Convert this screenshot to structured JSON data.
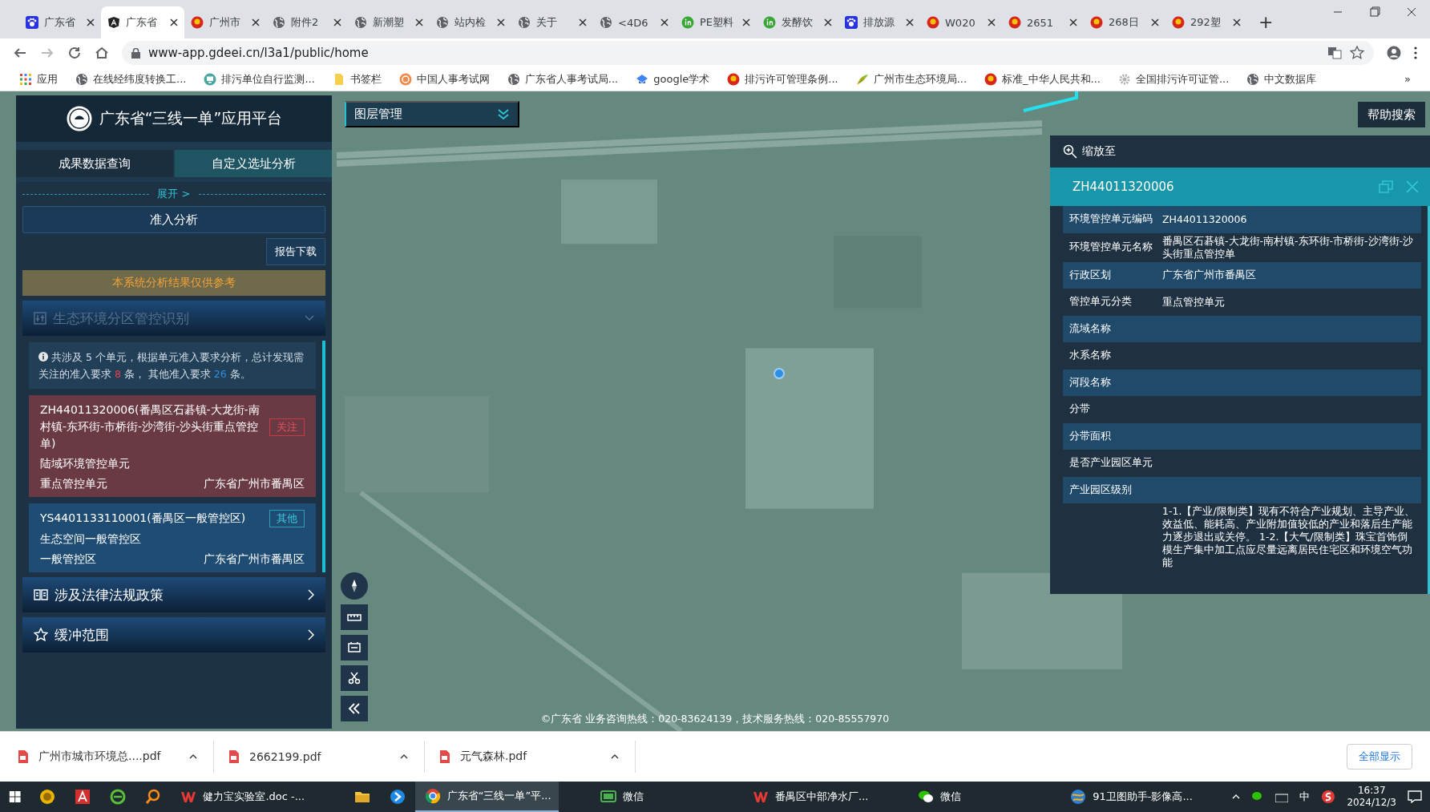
{
  "browser": {
    "tabs": [
      {
        "title": "广东省",
        "selected": false
      },
      {
        "title": "广东省",
        "selected": true
      },
      {
        "title": "广州市",
        "selected": false
      },
      {
        "title": "附件2",
        "selected": false
      },
      {
        "title": "新潮塑",
        "selected": false
      },
      {
        "title": "站内检",
        "selected": false
      },
      {
        "title": "关于",
        "selected": false
      },
      {
        "title": "<4D6",
        "selected": false
      },
      {
        "title": "PE塑料",
        "selected": false
      },
      {
        "title": "发酵饮",
        "selected": false
      },
      {
        "title": "排放源",
        "selected": false
      },
      {
        "title": "W020",
        "selected": false
      },
      {
        "title": "2651",
        "selected": false
      },
      {
        "title": "268日",
        "selected": false
      },
      {
        "title": "292塑",
        "selected": false
      }
    ],
    "new_tab": "+",
    "url": "www-app.gdeei.cn/l3a1/public/home",
    "bookmarks": [
      "应用",
      "在线经纬度转换工...",
      "排污单位自行监测...",
      "书签栏",
      "中国人事考试网",
      "广东省人事考试局...",
      "google学术",
      "排污许可管理条例...",
      "广州市生态环境局...",
      "标准_中华人民共和...",
      "全国排污许可证管...",
      "中文数据库"
    ],
    "bookmarks_more": "»"
  },
  "app": {
    "title": "广东省“三线一单”应用平台",
    "tabs": [
      {
        "label": "成果数据查询",
        "selected": false
      },
      {
        "label": "自定义选址分析",
        "selected": true
      }
    ],
    "expand_link": "展开 >",
    "analysis_button": "准入分析",
    "report_button": "报告下载",
    "notice": "本系统分析结果仅供参考",
    "sections": [
      {
        "title": "生态环境分区管控识别",
        "expanded": true,
        "summary": [
          {
            "kind": "text",
            "text": "共涉及 5 个单元，根据单元准入要求分析，总计发现需关注的准入要求 "
          },
          {
            "kind": "attention",
            "text": "8"
          },
          {
            "kind": "text",
            "text": " 条， 其他准入要求 "
          },
          {
            "kind": "other",
            "text": "26"
          },
          {
            "kind": "text",
            "text": " 条。"
          }
        ],
        "cards": [
          {
            "kind": "attention",
            "name": "ZH44011320006(番禺区石碁镇-大龙街-南村镇-东环街-市桥街-沙湾街-沙头街重点管控单)",
            "tag": "关注",
            "type": "陆域环境管控单元",
            "category": "重点管控单元",
            "region": "广东省广州市番禺区"
          },
          {
            "kind": "other",
            "name": "YS4401133110001(番禺区一般管控区)",
            "tag": "其他",
            "type": "生态空间一般管控区",
            "category": "一般管控区",
            "region": "广东省广州市番禺区"
          }
        ]
      },
      {
        "title": "涉及法律法规政策",
        "expanded": false
      },
      {
        "title": "缓冲范围",
        "expanded": false
      }
    ]
  },
  "map": {
    "layer_menu": "图层管理",
    "help_button": "帮助搜索",
    "footer": "©广东省 业务咨询热线：020-83624139，技术服务热线：020-85557970"
  },
  "popup": {
    "zoom_to": "缩放至",
    "title": "ZH44011320006",
    "rows": [
      {
        "label": "环境管控单元编码",
        "value": "ZH44011320006"
      },
      {
        "label": "环境管控单元名称",
        "value": "番禺区石碁镇-大龙街-南村镇-东环街-市桥街-沙湾街-沙头街重点管控单"
      },
      {
        "label": "行政区划",
        "value": "广东省广州市番禺区"
      },
      {
        "label": "管控单元分类",
        "value": "重点管控单元"
      },
      {
        "label": "流域名称"
      },
      {
        "label": "水系名称"
      },
      {
        "label": "河段名称"
      },
      {
        "label": "分带"
      },
      {
        "label": "分带面积"
      },
      {
        "label": "是否产业园区单元"
      },
      {
        "label": "产业园区级别"
      },
      {
        "value": "1-1.【产业/限制类】现有不符合产业规划、主导产业、效益低、能耗高、产业附加值较低的产业和落后生产能力逐步退出或关停。 1-2.【大气/限制类】珠宝首饰倒模生产集中加工点应尽量远离居民住宅区和环境空气功能"
      }
    ]
  },
  "downloads": {
    "files": [
      "广州市城市环境总....pdf",
      "2662199.pdf",
      "元气森林.pdf"
    ],
    "show_all": "全部显示"
  },
  "taskbar": {
    "items": [
      {
        "kind": "app",
        "active": false
      },
      {
        "kind": "app",
        "active": false
      },
      {
        "kind": "app",
        "active": false
      },
      {
        "kind": "app",
        "active": false
      },
      {
        "kind": "window",
        "label": "健力宝实验室.doc -...",
        "active": false
      },
      {
        "kind": "app",
        "active": false
      },
      {
        "kind": "app",
        "active": false
      },
      {
        "kind": "window",
        "label": "广东省“三线一单”平...",
        "active": true
      },
      {
        "kind": "window",
        "label": "微信",
        "active": false
      },
      {
        "kind": "window",
        "label": "番禺区中部净水厂...",
        "active": false
      },
      {
        "kind": "window",
        "label": "微信",
        "active": false
      },
      {
        "kind": "window",
        "label": "91卫图助手-影像高...",
        "active": false
      }
    ],
    "ime": "中",
    "time": "16:37",
    "date": "2024/12/3"
  }
}
